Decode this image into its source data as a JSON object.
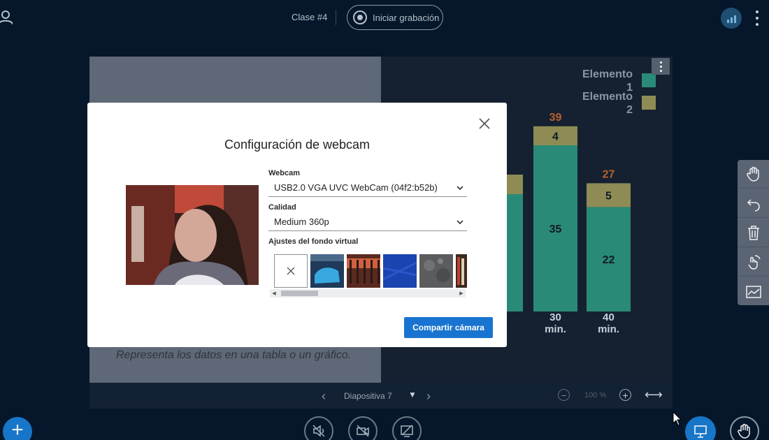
{
  "topbar": {
    "class_title": "Clase #4",
    "record_label": "Iniciar grabación"
  },
  "presentation": {
    "slide_text": "Representa los datos en una tabla o un gráfico.",
    "slide_selector": "Diapositiva 7",
    "zoom_level": "100 %",
    "prev_label": "‹",
    "next_label": "›",
    "zoom_out_label": "−",
    "zoom_in_label": "+",
    "fit_label": "⟷"
  },
  "chart_data": {
    "type": "bar",
    "categories": [
      "30\nmin.",
      "40\nmin."
    ],
    "series": [
      {
        "name": "Elemento 1",
        "values": [
          35,
          22
        ],
        "color": "#2a8a78"
      },
      {
        "name": "Elemento 2",
        "values": [
          4,
          5
        ],
        "color": "#8e8c54"
      }
    ],
    "totals": [
      39,
      27
    ],
    "total_color": "#b8612e",
    "partial_axis_text": "in."
  },
  "legend": {
    "items": [
      {
        "line1": "Elemento",
        "line2": "1",
        "color": "#2a8a78"
      },
      {
        "line1": "Elemento",
        "line2": "2",
        "color": "#8e8c54"
      }
    ]
  },
  "modal": {
    "title": "Configuración de webcam",
    "webcam_label": "Webcam",
    "webcam_value": "USB2.0 VGA UVC WebCam (04f2:b52b)",
    "quality_label": "Calidad",
    "quality_value": "Medium 360p",
    "background_label": "Ajustes del fondo virtual",
    "share_button": "Compartir cámara"
  },
  "bottombar": {
    "plus_label": "+"
  },
  "colors": {
    "primary": "#1874d0",
    "background": "#06172b"
  }
}
